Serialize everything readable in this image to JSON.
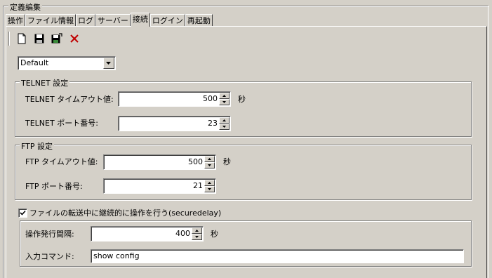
{
  "header": {
    "title": "定義編集"
  },
  "tabs": [
    {
      "label": "操作",
      "active": false
    },
    {
      "label": "ファイル情報",
      "active": false
    },
    {
      "label": "ログ",
      "active": false
    },
    {
      "label": "サーバー",
      "active": false
    },
    {
      "label": "接続",
      "active": true
    },
    {
      "label": "ログイン",
      "active": false
    },
    {
      "label": "再起動",
      "active": false
    }
  ],
  "toolbar": {
    "icons": [
      "new-document-icon",
      "save-icon",
      "save-as-icon",
      "delete-icon"
    ],
    "delete_color": "#c00000"
  },
  "profile_select": {
    "value": "Default"
  },
  "telnet": {
    "legend": "TELNET 設定",
    "timeout_label": "TELNET タイムアウト値:",
    "timeout_value": "500",
    "timeout_unit": "秒",
    "port_label": "TELNET ポート番号:",
    "port_value": "23"
  },
  "ftp": {
    "legend": "FTP 設定",
    "timeout_label": "FTP タイムアウト値:",
    "timeout_value": "500",
    "timeout_unit": "秒",
    "port_label": "FTP ポート番号:",
    "port_value": "21"
  },
  "secure_delay": {
    "checkbox_label": "ファイルの転送中に継続的に操作を行う(securedelay)",
    "checked": true,
    "interval_label": "操作発行間隔:",
    "interval_value": "400",
    "interval_unit": "秒",
    "command_label": "入力コマンド:",
    "command_value": "show config"
  }
}
